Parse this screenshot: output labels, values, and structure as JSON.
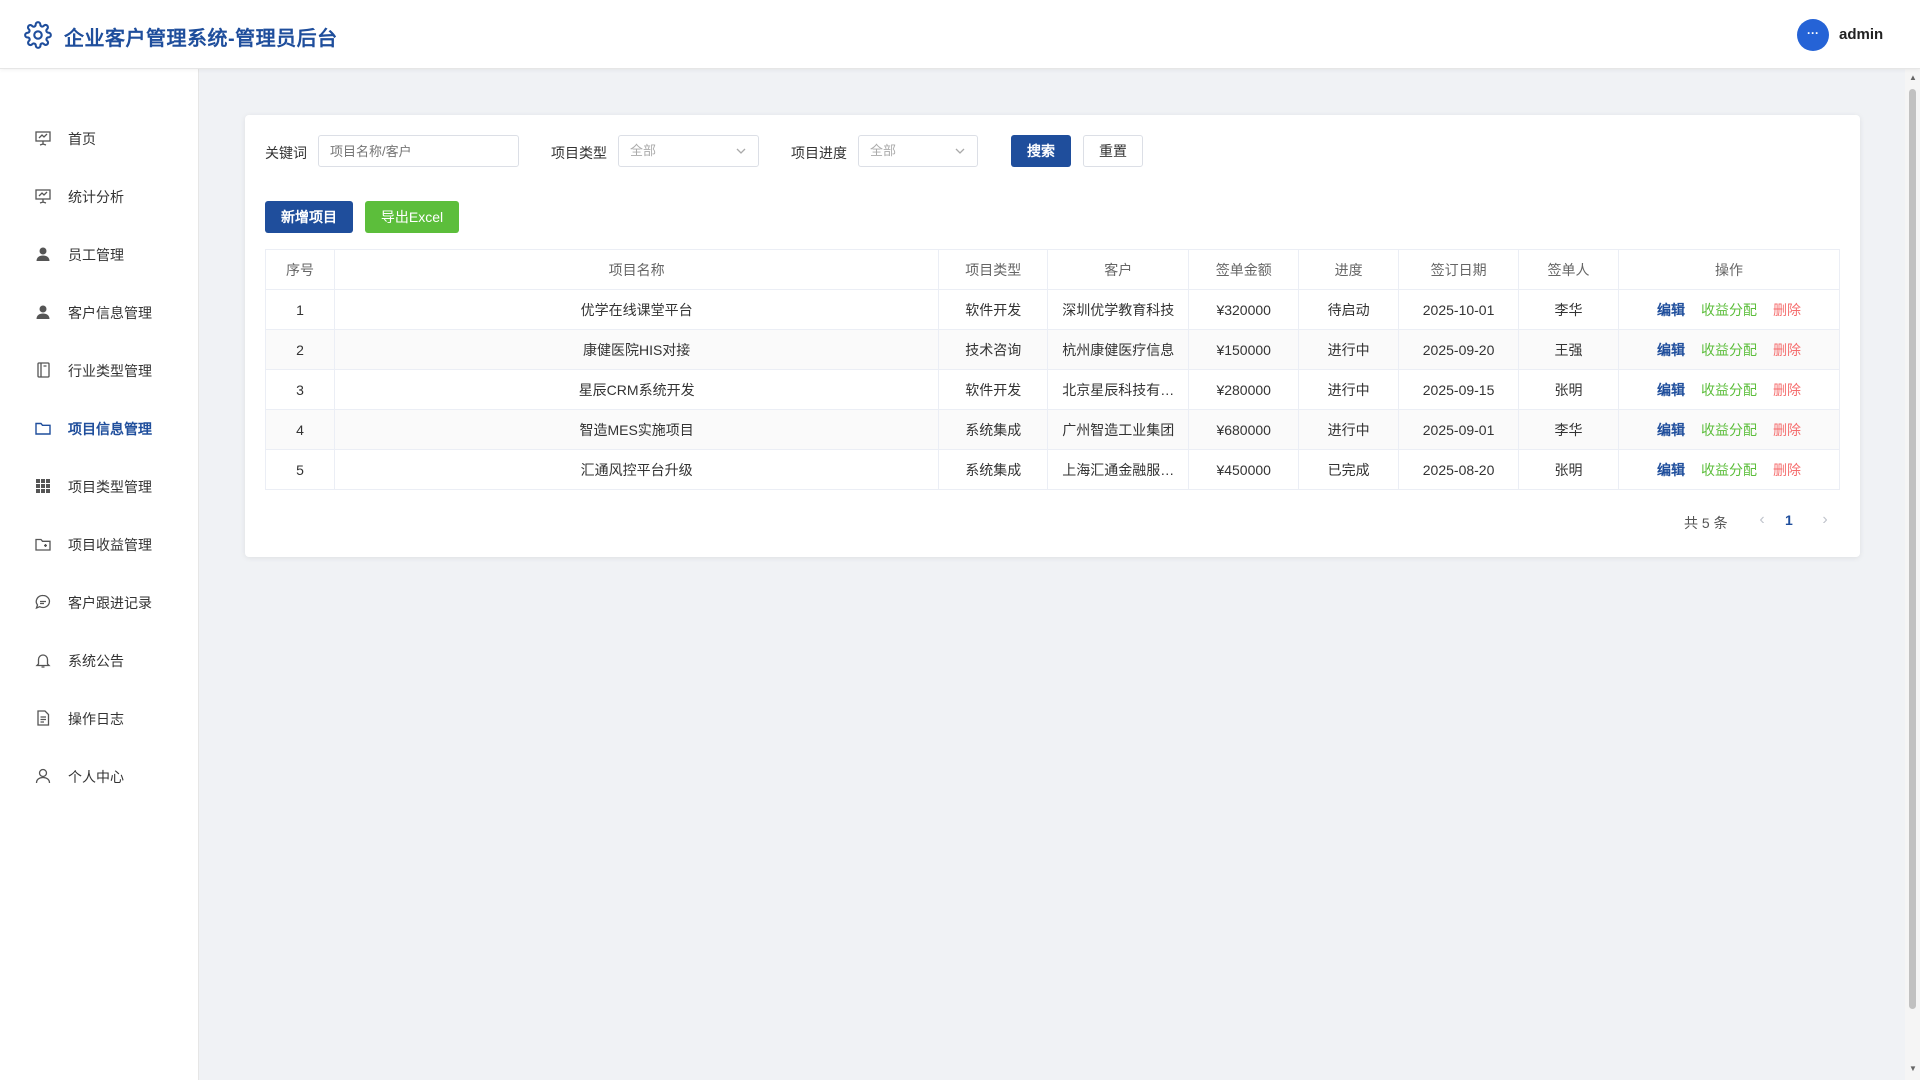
{
  "header": {
    "title": "企业客户管理系统-管理员后台",
    "avatar_text": "···",
    "username": "admin"
  },
  "sidebar": {
    "items": [
      {
        "label": "首页",
        "icon": "presentation-icon"
      },
      {
        "label": "统计分析",
        "icon": "presentation-chart-icon"
      },
      {
        "label": "员工管理",
        "icon": "user-filled-icon"
      },
      {
        "label": "客户信息管理",
        "icon": "user-filled-icon"
      },
      {
        "label": "行业类型管理",
        "icon": "notebook-icon"
      },
      {
        "label": "项目信息管理",
        "icon": "folder-icon",
        "active": true
      },
      {
        "label": "项目类型管理",
        "icon": "grid-icon"
      },
      {
        "label": "项目收益管理",
        "icon": "folder-add-icon"
      },
      {
        "label": "客户跟进记录",
        "icon": "chat-icon"
      },
      {
        "label": "系统公告",
        "icon": "bell-icon"
      },
      {
        "label": "操作日志",
        "icon": "document-icon"
      },
      {
        "label": "个人中心",
        "icon": "user-outline-icon"
      }
    ]
  },
  "filters": {
    "keyword_label": "关键词",
    "keyword_placeholder": "项目名称/客户",
    "type_label": "项目类型",
    "type_value": "全部",
    "progress_label": "项目进度",
    "progress_value": "全部",
    "search_label": "搜索",
    "reset_label": "重置"
  },
  "toolbar": {
    "add_label": "新增项目",
    "export_label": "导出Excel"
  },
  "table": {
    "columns": [
      "序号",
      "项目名称",
      "项目类型",
      "客户",
      "签单金额",
      "进度",
      "签订日期",
      "签单人",
      "操作"
    ],
    "rows": [
      {
        "no": "1",
        "name": "优学在线课堂平台",
        "type": "软件开发",
        "client": "深圳优学教育科技",
        "amount": "¥320000",
        "progress": "待启动",
        "date": "2025-10-01",
        "signer": "李华"
      },
      {
        "no": "2",
        "name": "康健医院HIS对接",
        "type": "技术咨询",
        "client": "杭州康健医疗信息",
        "amount": "¥150000",
        "progress": "进行中",
        "date": "2025-09-20",
        "signer": "王强"
      },
      {
        "no": "3",
        "name": "星辰CRM系统开发",
        "type": "软件开发",
        "client": "北京星辰科技有…",
        "amount": "¥280000",
        "progress": "进行中",
        "date": "2025-09-15",
        "signer": "张明"
      },
      {
        "no": "4",
        "name": "智造MES实施项目",
        "type": "系统集成",
        "client": "广州智造工业集团",
        "amount": "¥680000",
        "progress": "进行中",
        "date": "2025-09-01",
        "signer": "李华"
      },
      {
        "no": "5",
        "name": "汇通风控平台升级",
        "type": "系统集成",
        "client": "上海汇通金融服…",
        "amount": "¥450000",
        "progress": "已完成",
        "date": "2025-08-20",
        "signer": "张明"
      }
    ],
    "actions": {
      "edit": "编辑",
      "profit": "收益分配",
      "delete": "删除"
    }
  },
  "pagination": {
    "total_text": "共 5 条",
    "current_page": "1"
  },
  "colors": {
    "brand": "#1f4e9c",
    "success": "#5cbe3b",
    "danger": "#f56c6c"
  }
}
